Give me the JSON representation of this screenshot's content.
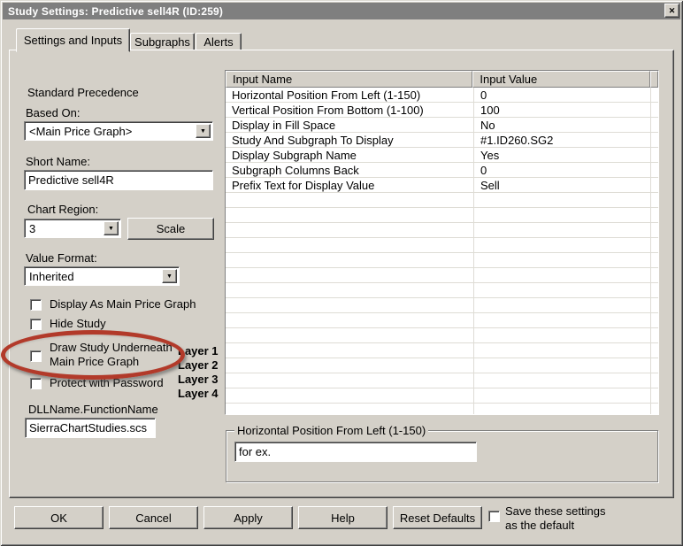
{
  "window": {
    "title": "Study Settings: Predictive sell4R  (ID:259)"
  },
  "icons": {
    "close": "✕",
    "dropdown": "▼"
  },
  "colors": {
    "dialog_bg": "#d4d0c8",
    "titlebar_bg": "#7f7f7f",
    "annotation_red": "#b23a2a"
  },
  "tabs": [
    {
      "label": "Settings and Inputs",
      "active": true
    },
    {
      "label": "Subgraphs",
      "active": false
    },
    {
      "label": "Alerts",
      "active": false
    }
  ],
  "left": {
    "precedence_label": "Standard Precedence",
    "based_on": {
      "label": "Based On:",
      "value": "<Main Price Graph>"
    },
    "short_name": {
      "label": "Short Name:",
      "value": "Predictive sell4R"
    },
    "chart_region": {
      "label": "Chart Region:",
      "value": "3",
      "scale_button": "Scale"
    },
    "value_format": {
      "label": "Value Format:",
      "value": "Inherited"
    },
    "checkboxes": [
      {
        "label": "Display As Main Price Graph",
        "checked": false
      },
      {
        "label": "Hide Study",
        "checked": false
      },
      {
        "label": "Draw Study Underneath Main Price Graph",
        "lines": [
          "Draw Study Underneath",
          "Main Price Graph"
        ],
        "checked": false
      },
      {
        "label": "Protect with Password",
        "checked": false
      }
    ],
    "layers": [
      "Layer 1",
      "Layer 2",
      "Layer 3",
      "Layer 4"
    ],
    "dll": {
      "label": "DLLName.FunctionName",
      "value": "SierraChartStudies.scs"
    }
  },
  "inputs_table": {
    "columns": [
      "Input Name",
      "Input Value"
    ],
    "rows": [
      {
        "name": "Horizontal Position From Left (1-150)",
        "value": "0"
      },
      {
        "name": "Vertical Position From Bottom (1-100)",
        "value": "100"
      },
      {
        "name": "Display in Fill Space",
        "value": "No"
      },
      {
        "name": "Study And Subgraph To Display",
        "value": "#1.ID260.SG2"
      },
      {
        "name": "Display Subgraph Name",
        "value": "Yes"
      },
      {
        "name": "Subgraph Columns Back",
        "value": "0"
      },
      {
        "name": "Prefix Text for Display Value",
        "value": "Sell"
      }
    ]
  },
  "group": {
    "title": "Horizontal Position From Left (1-150)",
    "value": "for ex."
  },
  "footer": {
    "buttons": [
      "OK",
      "Cancel",
      "Apply",
      "Help",
      "Reset Defaults"
    ],
    "save": {
      "lines": [
        "Save these settings",
        "as the default"
      ],
      "checked": false
    }
  }
}
